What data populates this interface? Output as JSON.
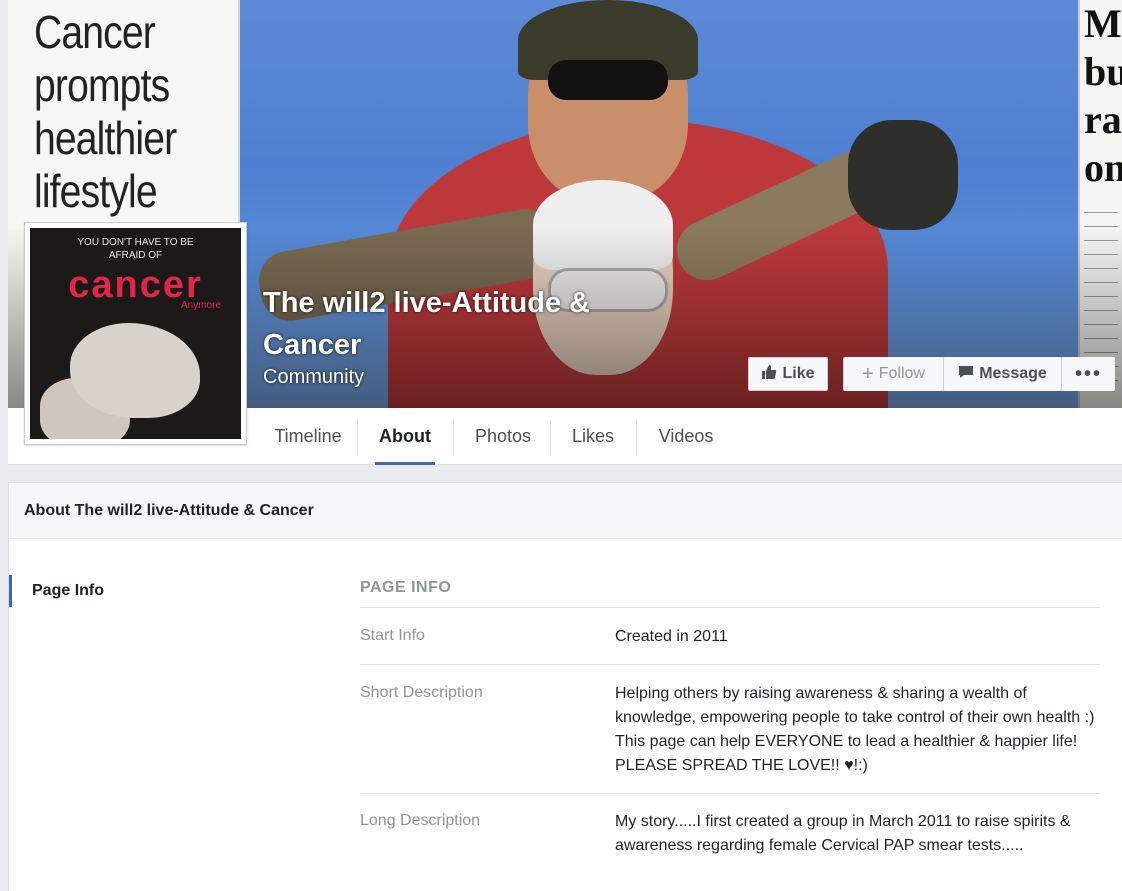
{
  "cover": {
    "clipping_left_headline": "Cancer prompts healthier lifestyle",
    "clipping_right_headline": "M\nbu\nra\non",
    "page_name": "The will2 live-Attitude & Cancer",
    "page_category": "Community"
  },
  "profile_picture": {
    "tagline": "YOU DON'T HAVE TO BE AFRAID OF",
    "word": "cancer",
    "sub": "Anymore"
  },
  "actions": {
    "like_label": "Like",
    "like_icon": "thumbs-up-icon",
    "follow_label": "Follow",
    "follow_icon": "plus-icon",
    "message_label": "Message",
    "message_icon": "speech-bubble-icon",
    "more_label": "•••"
  },
  "nav": {
    "tabs": [
      {
        "label": "Timeline",
        "active": false
      },
      {
        "label": "About",
        "active": true
      },
      {
        "label": "Photos",
        "active": false
      },
      {
        "label": "Likes",
        "active": false
      },
      {
        "label": "Videos",
        "active": false
      }
    ]
  },
  "about": {
    "header": "About The will2 live-Attitude & Cancer",
    "sidebar_item": "Page Info",
    "section_heading": "PAGE INFO",
    "rows": [
      {
        "label": "Start Info",
        "value": "Created in 2011"
      },
      {
        "label": "Short Description",
        "value": "Helping others by raising awareness & sharing a wealth of knowledge, empowering people to take control of their own health :) This page can help EVERYONE to lead a healthier & happier life! PLEASE SPREAD THE LOVE!! ♥!:)"
      },
      {
        "label": "Long Description",
        "value": "My story.....I first created a group in March 2011 to raise spirits & awareness regarding female Cervical PAP smear tests....."
      }
    ]
  },
  "colors": {
    "accent": "#4267b2",
    "muted_text": "#90949c",
    "page_bg": "#e9ebee"
  }
}
